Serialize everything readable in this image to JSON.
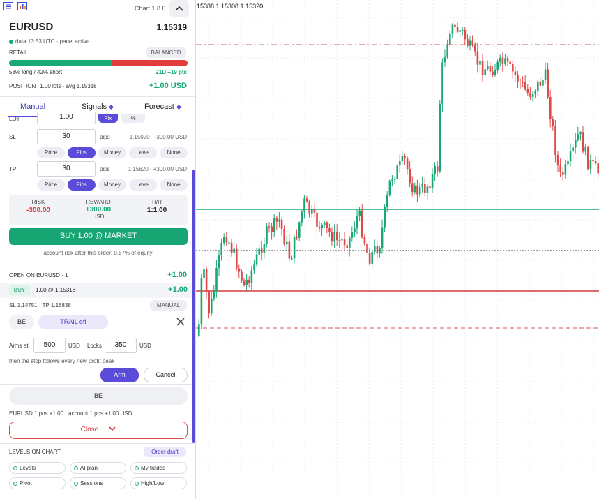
{
  "app": {
    "version": "Chart 1.8.0"
  },
  "header": {
    "symbol": "EURUSD",
    "price": "1.15319",
    "status": "data 13:53 UTC · panel active"
  },
  "sentiment": {
    "label": "RETAIL",
    "badge": "BALANCED",
    "long_pct": 58,
    "text": "58% long / 42% short",
    "change": "21D +19 pts",
    "colors": {
      "long": "#18a974",
      "short": "#e23d3d"
    }
  },
  "position": {
    "label": "POSITION",
    "desc": "1.00 lots · avg 1.15318",
    "pl": "+1.00 USD"
  },
  "tabs": [
    {
      "label": "Manual"
    },
    {
      "label": "Signals"
    },
    {
      "label": "Forecast"
    }
  ],
  "order": {
    "lot_label": "LOT",
    "lot_value": "1.00",
    "lot_unit_fix": "Fix",
    "lot_unit_pct": "%",
    "sl": {
      "label": "SL",
      "value": "30",
      "unit": "pips",
      "hint": "1.15020 · -300.00 USD",
      "modes": [
        "Price",
        "Pips",
        "Money",
        "Level",
        "None"
      ],
      "active": "Pips"
    },
    "tp": {
      "label": "TP",
      "value": "30",
      "unit": "pips",
      "hint": "1.15620 · +300.00 USD",
      "modes": [
        "Price",
        "Pips",
        "Money",
        "Level",
        "None"
      ],
      "active": "Pips"
    },
    "risk": {
      "label": "RISK",
      "value": "-300.00"
    },
    "reward": {
      "label": "REWARD",
      "value": "+300.00",
      "unit": "USD"
    },
    "rr": {
      "label": "R/R",
      "value": "1:1.00"
    },
    "buy_button": "BUY 1.00 @ MARKET",
    "account_risk": "account risk after this order: 0.87% of equity"
  },
  "open": {
    "title": "OPEN ON EURUSD · 1",
    "pl": "+1.00",
    "trade": {
      "side": "BUY",
      "desc": "1.00 @ 1.15318",
      "pl": "+1.00"
    },
    "sltp": "SL 1.14751 · TP 1.16838",
    "mode_badge": "MANUAL",
    "be_label": "BE",
    "trail_label": "TRAIL off",
    "arms_label": "Arms at",
    "arms_value": "500",
    "arms_unit": "USD",
    "locks_label": "Locks",
    "locks_value": "350",
    "locks_unit": "USD",
    "trail_hint": "then the stop follows every new profit peak",
    "arm_button": "Arm",
    "cancel_button": "Cancel",
    "be_button": "BE",
    "summary": "EURUSD 1 pos +1.00 · account 1 pos +1.00 USD",
    "close_button": "Close..."
  },
  "levels": {
    "title": "LEVELS ON CHART",
    "order_draft": "Order draft",
    "items": [
      "Levels",
      "AI plan",
      "My trades",
      "Pivot",
      "Sessions",
      "High/Low"
    ]
  },
  "chart": {
    "ohlc": "15388 1.15308 1.15320",
    "colors": {
      "up": "#19a874",
      "down": "#e04848",
      "entry": "#18a974",
      "sl": "#d33c3c",
      "tp_dash": "#d25555"
    }
  }
}
